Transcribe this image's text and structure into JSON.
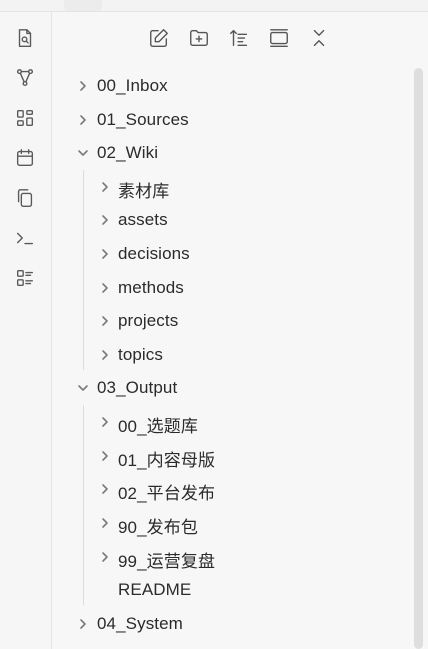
{
  "ribbon": {
    "items": [
      {
        "icon": "search-file-icon"
      },
      {
        "icon": "graph-icon"
      },
      {
        "icon": "canvas-grid-icon"
      },
      {
        "icon": "calendar-icon"
      },
      {
        "icon": "copy-icon"
      },
      {
        "icon": "terminal-icon"
      },
      {
        "icon": "list-icon"
      }
    ]
  },
  "nav_header": {
    "buttons": [
      {
        "icon": "new-note-icon"
      },
      {
        "icon": "new-folder-icon"
      },
      {
        "icon": "sort-icon"
      },
      {
        "icon": "auto-reveal-icon"
      },
      {
        "icon": "collapse-all-icon"
      }
    ]
  },
  "tree": {
    "inbox": "00_Inbox",
    "sources": "01_Sources",
    "wiki": "02_Wiki",
    "wiki_children": [
      "素材库",
      "assets",
      "decisions",
      "methods",
      "projects",
      "topics"
    ],
    "output": "03_Output",
    "output_children": [
      "00_选题库",
      "01_内容母版",
      "02_平台发布",
      "90_发布包",
      "99_运营复盘"
    ],
    "readme": "README",
    "system": "04_System"
  }
}
